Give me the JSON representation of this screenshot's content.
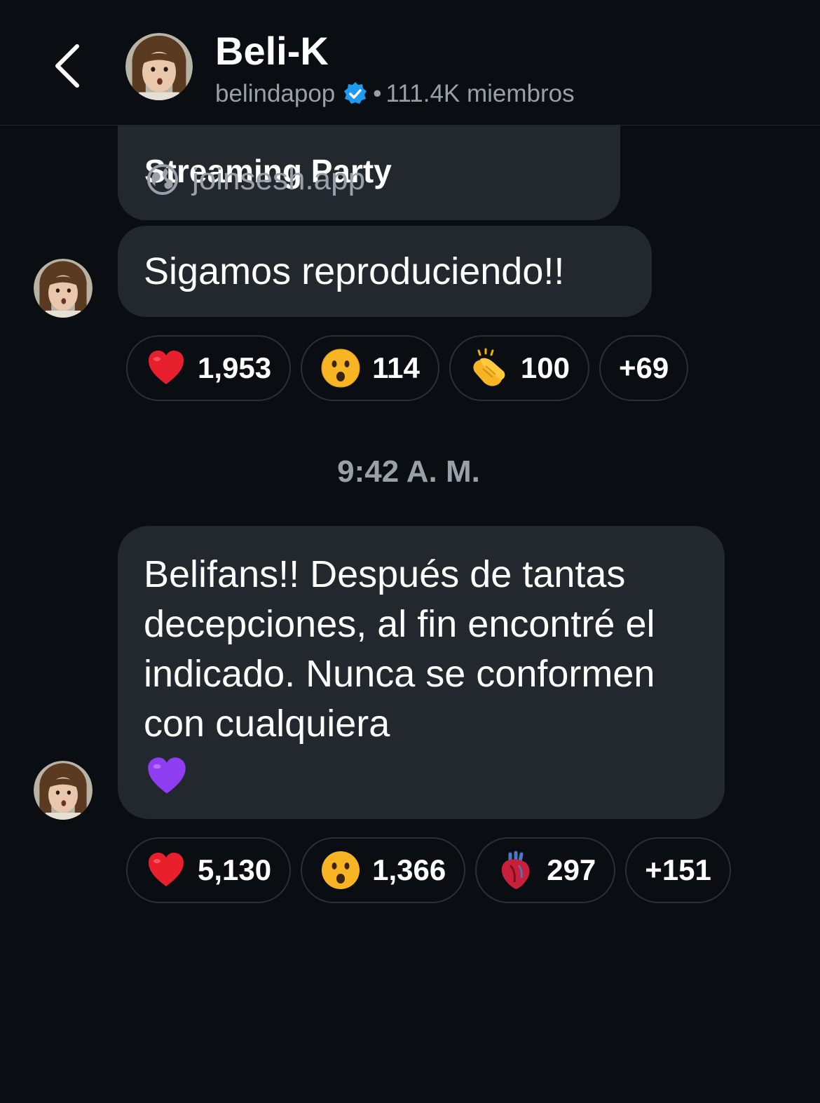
{
  "header": {
    "channel_name": "Beli-K",
    "handle": "belindapop",
    "separator": "•",
    "members": "111.4K miembros"
  },
  "link_preview": {
    "title": "Streaming Party",
    "domain": "joinsesh.app"
  },
  "messages": [
    {
      "text": "Sigamos reproduciendo!!",
      "reactions": [
        {
          "emoji": "red-heart",
          "count": "1,953"
        },
        {
          "emoji": "hushed-face",
          "count": "114"
        },
        {
          "emoji": "clapping-hands",
          "count": "100"
        },
        {
          "more": "+69"
        }
      ]
    },
    {
      "text": "Belifans!! Después de tantas decepciones, al fin encontré el indicado. Nunca se conformen con cualquiera",
      "trailing_emoji": "purple-heart",
      "reactions": [
        {
          "emoji": "red-heart",
          "count": "5,130"
        },
        {
          "emoji": "hushed-face",
          "count": "1,366"
        },
        {
          "emoji": "anatomical-heart",
          "count": "297"
        },
        {
          "more": "+151"
        }
      ]
    }
  ],
  "timestamp": "9:42 A. M.",
  "colors": {
    "background": "#0a0d12",
    "bubble": "#23272e",
    "muted_text": "#9aa0a8",
    "verified_blue": "#1d9bf0"
  }
}
